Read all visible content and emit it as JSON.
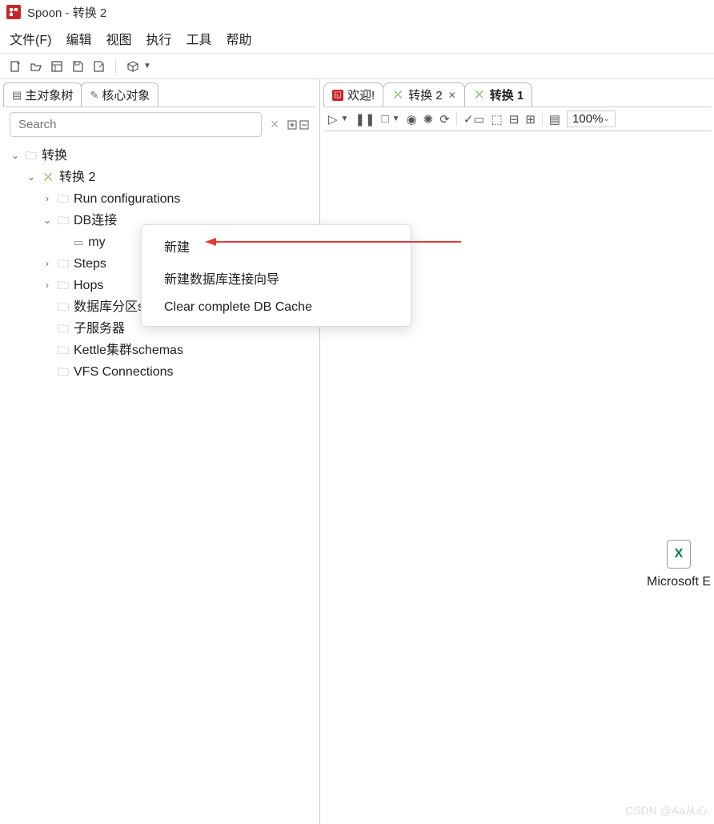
{
  "title": "Spoon - 转换 2",
  "menubar": [
    "文件(F)",
    "编辑",
    "视图",
    "执行",
    "工具",
    "帮助"
  ],
  "left_tabs": [
    {
      "icon": "document",
      "label": "主对象树"
    },
    {
      "icon": "pencil",
      "label": "核心对象"
    }
  ],
  "search": {
    "placeholder": "Search"
  },
  "tree": {
    "root": "转换",
    "node": "转换 2",
    "children": [
      {
        "label": "Run configurations",
        "expandable": true
      },
      {
        "label": "DB连接",
        "expandable": true,
        "expanded": true,
        "child": "my"
      },
      {
        "label": "Steps",
        "expandable": true
      },
      {
        "label": "Hops",
        "expandable": true
      },
      {
        "label": "数据库分区schemas",
        "expandable": false
      },
      {
        "label": "子服务器",
        "expandable": false
      },
      {
        "label": "Kettle集群schemas",
        "expandable": false
      },
      {
        "label": "VFS Connections",
        "expandable": false
      }
    ]
  },
  "right_tabs": [
    {
      "label": "欢迎!",
      "type": "welcome"
    },
    {
      "label": "转换 2",
      "type": "trans",
      "closable": true
    },
    {
      "label": "转换 1",
      "type": "trans",
      "active": true
    }
  ],
  "zoom": "100%",
  "context_menu": [
    "新建",
    "新建数据库连接向导",
    "Clear complete DB Cache"
  ],
  "excel": {
    "label": "Microsoft E"
  },
  "watermark": "CSDN @Aa从心"
}
